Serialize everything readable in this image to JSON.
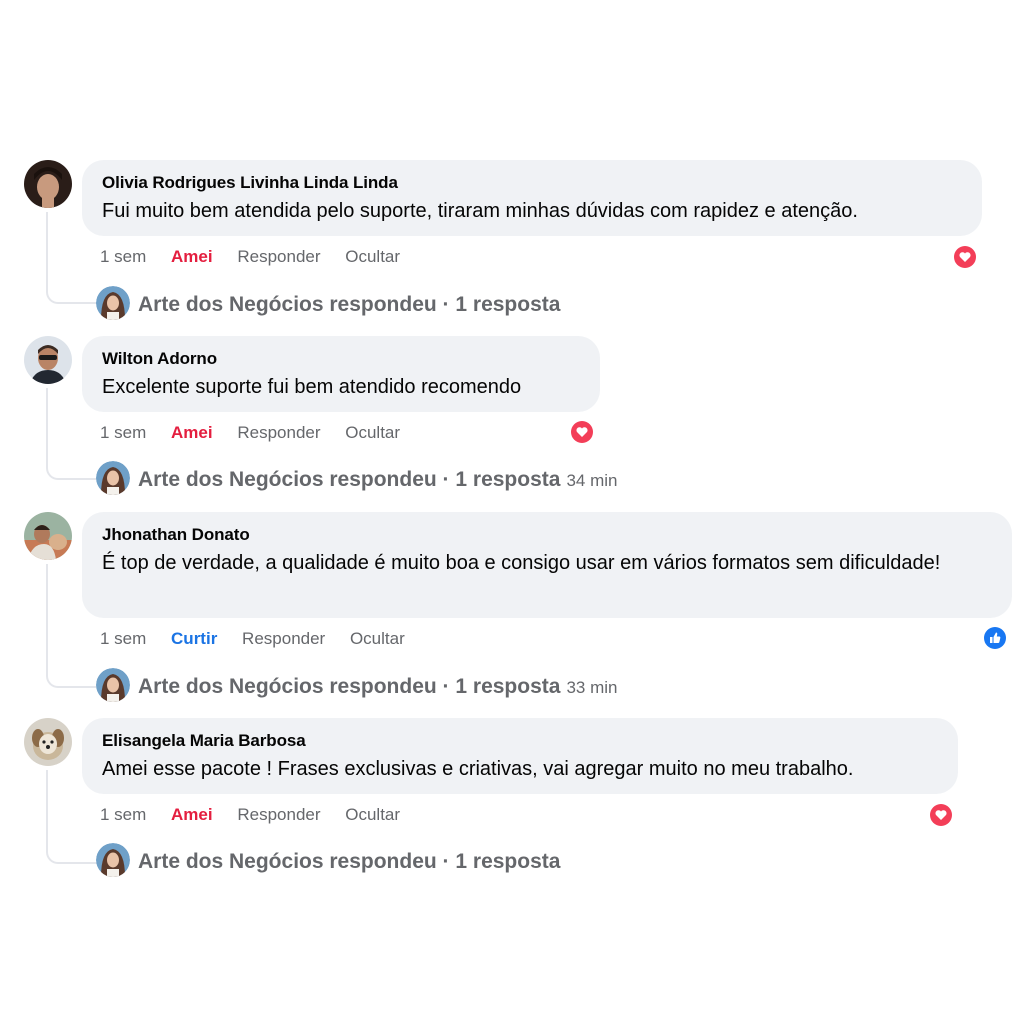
{
  "comments": [
    {
      "author": "Olivia Rodrigues Livinha Linda Linda",
      "text": "Fui muito bem atendida pelo suporte, tiraram minhas dúvidas com rapidez e atenção.",
      "time": "1 sem",
      "reaction_label": "Amei",
      "reply_label": "Responder",
      "hide_label": "Ocultar",
      "reaction_icon": "heart-icon",
      "replied": "Arte dos Negócios respondeu · 1 resposta",
      "reply_time": ""
    },
    {
      "author": "Wilton Adorno",
      "text": "Excelente suporte fui bem atendido recomendo",
      "time": "1 sem",
      "reaction_label": "Amei",
      "reply_label": "Responder",
      "hide_label": "Ocultar",
      "reaction_icon": "heart-icon",
      "replied": "Arte dos Negócios respondeu · 1 resposta",
      "reply_time": "34 min"
    },
    {
      "author": "Jhonathan Donato",
      "text": "É top de verdade, a qualidade é muito boa e consigo usar em vários formatos sem dificuldade!",
      "time": "1 sem",
      "reaction_label": "Curtir",
      "reply_label": "Responder",
      "hide_label": "Ocultar",
      "reaction_icon": "like-icon",
      "replied": "Arte dos Negócios respondeu · 1 resposta",
      "reply_time": "33 min"
    },
    {
      "author": "Elisangela Maria Barbosa",
      "text": "Amei esse pacote ! Frases exclusivas e criativas, vai agregar muito no meu trabalho.",
      "time": "1 sem",
      "reaction_label": "Amei",
      "reply_label": "Responder",
      "hide_label": "Ocultar",
      "reaction_icon": "heart-icon",
      "replied": "Arte dos Negócios respondeu · 1 resposta",
      "reply_time": ""
    }
  ],
  "colors": {
    "bubble": "#f0f2f5",
    "amei": "#e41e3f",
    "curtir": "#1b74e4",
    "muted": "#65676b"
  }
}
